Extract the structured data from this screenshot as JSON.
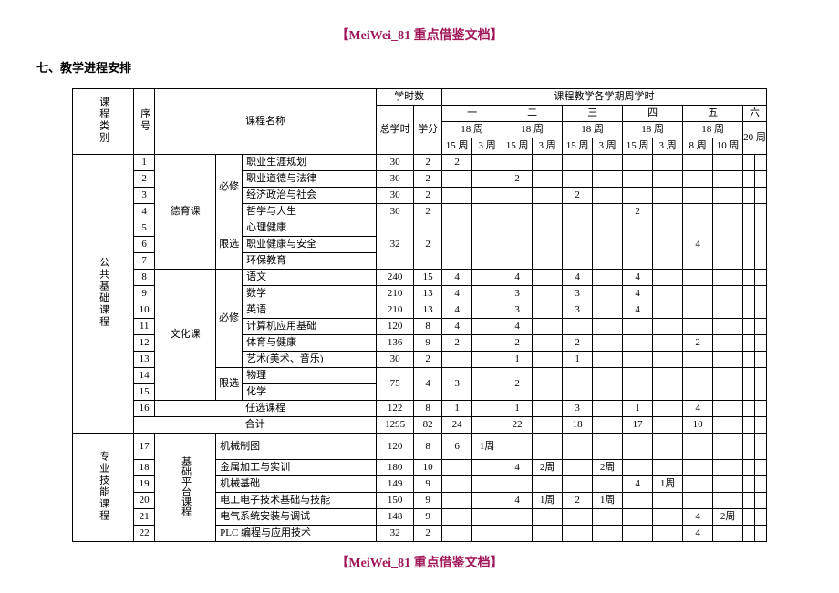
{
  "watermark": "【MeiWei_81 重点借鉴文档】",
  "heading": "七、教学进程安排",
  "headers": {
    "category": "课程类别",
    "no": "序号",
    "course_name": "课程名称",
    "hours_group": "学时数",
    "total": "总学时",
    "credit": "学分",
    "sem_group": "课程教学各学期周学时",
    "sem": [
      "一",
      "二",
      "三",
      "四",
      "五",
      "六"
    ],
    "week18": "18 周",
    "week20": "20 周",
    "sub15": "15 周",
    "sub3": "3 周",
    "sub8": "8 周",
    "sub10": "10 周"
  },
  "cats": {
    "pub": "公共基础课程",
    "pro": "专业技能课程"
  },
  "sub": {
    "deyu": "德育课",
    "wenhua": "文化课",
    "jichu": "基础平台课程"
  },
  "mode": {
    "bixiu": "必修",
    "xianxuan": "限选"
  },
  "rows": [
    {
      "n": "1",
      "name": "职业生涯规划",
      "t": "30",
      "c": "2",
      "v": [
        "2",
        "",
        "",
        "",
        "",
        "",
        "",
        "",
        "",
        "",
        "",
        ""
      ]
    },
    {
      "n": "2",
      "name": "职业道德与法律",
      "t": "30",
      "c": "2",
      "v": [
        "",
        "",
        "2",
        "",
        "",
        "",
        "",
        "",
        "",
        "",
        "",
        ""
      ]
    },
    {
      "n": "3",
      "name": "经济政治与社会",
      "t": "30",
      "c": "2",
      "v": [
        "",
        "",
        "",
        "",
        "2",
        "",
        "",
        "",
        "",
        "",
        "",
        ""
      ]
    },
    {
      "n": "4",
      "name": "哲学与人生",
      "t": "30",
      "c": "2",
      "v": [
        "",
        "",
        "",
        "",
        "",
        "",
        "2",
        "",
        "",
        "",
        "",
        ""
      ]
    },
    {
      "n": "5",
      "name": "心理健康"
    },
    {
      "n": "6",
      "name": "职业健康与安全",
      "t": "32",
      "c": "2",
      "v": [
        "",
        "",
        "",
        "",
        "",
        "",
        "",
        "",
        "4",
        "",
        "",
        ""
      ]
    },
    {
      "n": "7",
      "name": "环保教育"
    },
    {
      "n": "8",
      "name": "语文",
      "t": "240",
      "c": "15",
      "v": [
        "4",
        "",
        "4",
        "",
        "4",
        "",
        "4",
        "",
        "",
        "",
        "",
        ""
      ]
    },
    {
      "n": "9",
      "name": "数学",
      "t": "210",
      "c": "13",
      "v": [
        "4",
        "",
        "3",
        "",
        "3",
        "",
        "4",
        "",
        "",
        "",
        "",
        ""
      ]
    },
    {
      "n": "10",
      "name": "英语",
      "t": "210",
      "c": "13",
      "v": [
        "4",
        "",
        "3",
        "",
        "3",
        "",
        "4",
        "",
        "",
        "",
        "",
        ""
      ]
    },
    {
      "n": "11",
      "name": "计算机应用基础",
      "t": "120",
      "c": "8",
      "v": [
        "4",
        "",
        "4",
        "",
        "",
        "",
        "",
        "",
        "",
        "",
        "",
        ""
      ]
    },
    {
      "n": "12",
      "name": "体育与健康",
      "t": "136",
      "c": "9",
      "v": [
        "2",
        "",
        "2",
        "",
        "2",
        "",
        "",
        "",
        "2",
        "",
        "",
        ""
      ]
    },
    {
      "n": "13",
      "name": "艺术(美术、音乐)",
      "t": "30",
      "c": "2",
      "v": [
        "",
        "",
        "1",
        "",
        "1",
        "",
        "",
        "",
        "",
        "",
        "",
        ""
      ]
    },
    {
      "n": "14",
      "name": "物理"
    },
    {
      "n": "15",
      "name": "化学",
      "t": "75",
      "c": "4",
      "v": [
        "3",
        "",
        "2",
        "",
        "",
        "",
        "",
        "",
        "",
        "",
        "",
        ""
      ]
    },
    {
      "n": "16",
      "name": "任选课程",
      "t": "122",
      "c": "8",
      "v": [
        "1",
        "",
        "1",
        "",
        "3",
        "",
        "1",
        "",
        "4",
        "",
        "",
        ""
      ]
    },
    {
      "sum": true,
      "name": "合计",
      "t": "1295",
      "c": "82",
      "v": [
        "24",
        "",
        "22",
        "",
        "18",
        "",
        "17",
        "",
        "10",
        "",
        "",
        ""
      ]
    },
    {
      "n": "17",
      "name": "机械制图",
      "t": "120",
      "c": "8",
      "v": [
        "6",
        "1周",
        "",
        "",
        "",
        "",
        "",
        "",
        "",
        "",
        "",
        ""
      ],
      "merge01": true
    },
    {
      "n": "18",
      "name": "金属加工与实训",
      "t": "180",
      "c": "10",
      "v": [
        "",
        "",
        "4",
        "2周",
        "",
        "2周",
        "",
        "",
        "",
        "",
        "",
        ""
      ]
    },
    {
      "n": "19",
      "name": "机械基础",
      "t": "149",
      "c": "9",
      "v": [
        "",
        "",
        "",
        "",
        "",
        "",
        "4",
        "1周",
        "",
        "",
        "",
        ""
      ]
    },
    {
      "n": "20",
      "name": "电工电子技术基础与技能",
      "t": "150",
      "c": "9",
      "v": [
        "",
        "",
        "4",
        "1周",
        "2",
        "1周",
        "",
        "",
        "",
        "",
        "",
        ""
      ]
    },
    {
      "n": "21",
      "name": "电气系统安装与调试",
      "t": "148",
      "c": "9",
      "v": [
        "",
        "",
        "",
        "",
        "",
        "",
        "",
        "",
        "4",
        "2周",
        "",
        ""
      ]
    },
    {
      "n": "22",
      "name": "PLC 编程与应用技术",
      "t": "32",
      "c": "2",
      "v": [
        "",
        "",
        "",
        "",
        "",
        "",
        "",
        "",
        "4",
        "",
        "",
        ""
      ]
    }
  ]
}
